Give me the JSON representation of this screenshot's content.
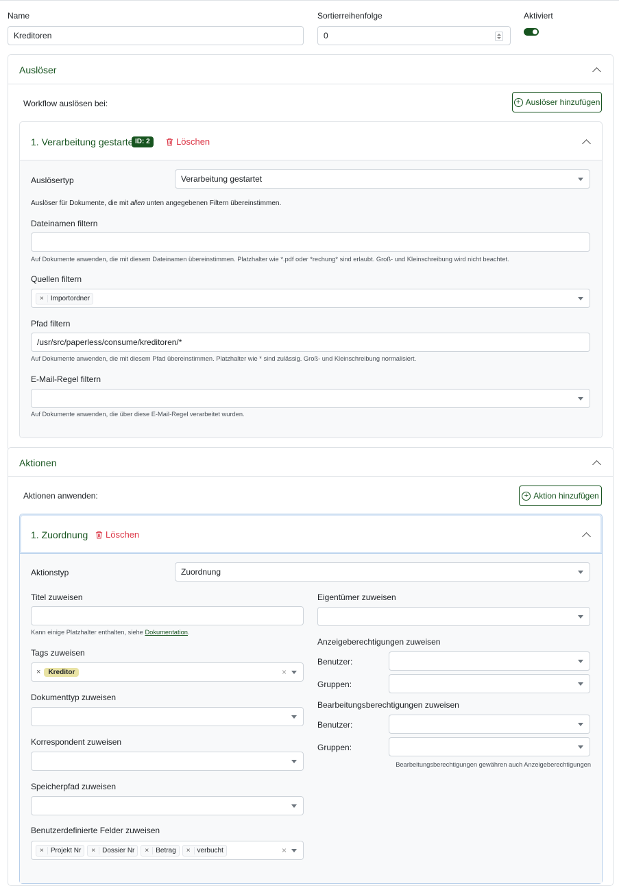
{
  "top": {
    "name_label": "Name",
    "name_value": "Kreditoren",
    "sort_label": "Sortierreihenfolge",
    "sort_value": "0",
    "enabled_label": "Aktiviert"
  },
  "triggers": {
    "title": "Auslöser",
    "intro": "Workflow auslösen bei:",
    "add_button": "Auslöser hinzufügen",
    "trigger1": {
      "title": "1. Verarbeitung gestartet",
      "id_badge": "ID: 2",
      "delete_label": "Löschen",
      "type_label": "Auslösertyp",
      "type_value": "Verarbeitung gestartet",
      "hint_pre": "Auslöser für Dokumente, die mit ",
      "hint_em": "allen",
      "hint_post": " unten angegebenen Filtern übereinstimmen.",
      "filename_label": "Dateinamen filtern",
      "filename_value": "",
      "filename_help": "Auf Dokumente anwenden, die mit diesem Dateinamen übereinstimmen. Platzhalter wie *.pdf oder *rechung* sind erlaubt. Groß- und Kleinschreibung wird nicht beachtet.",
      "sources_label": "Quellen filtern",
      "sources_chips": [
        "Importordner"
      ],
      "path_label": "Pfad filtern",
      "path_value": "/usr/src/paperless/consume/kreditoren/*",
      "path_help": "Auf Dokumente anwenden, die mit diesem Pfad übereinstimmen. Platzhalter wie * sind zulässig. Groß- und Kleinschreibung normalisiert.",
      "mailrule_label": "E-Mail-Regel filtern",
      "mailrule_help": "Auf Dokumente anwenden, die über diese E-Mail-Regel verarbeitet wurden."
    }
  },
  "actions": {
    "title": "Aktionen",
    "intro": "Aktionen anwenden:",
    "add_button": "Aktion hinzufügen",
    "action1": {
      "title": "1. Zuordnung",
      "delete_label": "Löschen",
      "type_label": "Aktionstyp",
      "type_value": "Zuordnung",
      "title_label": "Titel zuweisen",
      "title_help_pre": "Kann einige Platzhalter enthalten, siehe ",
      "title_help_link": "Dokumentation",
      "title_help_post": ".",
      "tags_label": "Tags zuweisen",
      "tags_value": "Kreditor",
      "doctype_label": "Dokumenttyp zuweisen",
      "correspondent_label": "Korrespondent zuweisen",
      "storagepath_label": "Speicherpfad zuweisen",
      "customfields_label": "Benutzerdefinierte Felder zuweisen",
      "customfields_chips": [
        "Projekt Nr",
        "Dossier Nr",
        "Betrag",
        "verbucht"
      ],
      "owner_label": "Eigentümer zuweisen",
      "view_perm_label": "Anzeigeberechtigungen zuweisen",
      "edit_perm_label": "Bearbeitungsberechtigungen zuweisen",
      "users_label": "Benutzer:",
      "groups_label": "Gruppen:",
      "edit_perm_help": "Bearbeitungsberechtigungen gewähren auch Anzeigeberechtigungen"
    }
  },
  "colors": {
    "accent": "#17541f",
    "danger": "#dc3545",
    "tag": "#e9e3a4"
  }
}
